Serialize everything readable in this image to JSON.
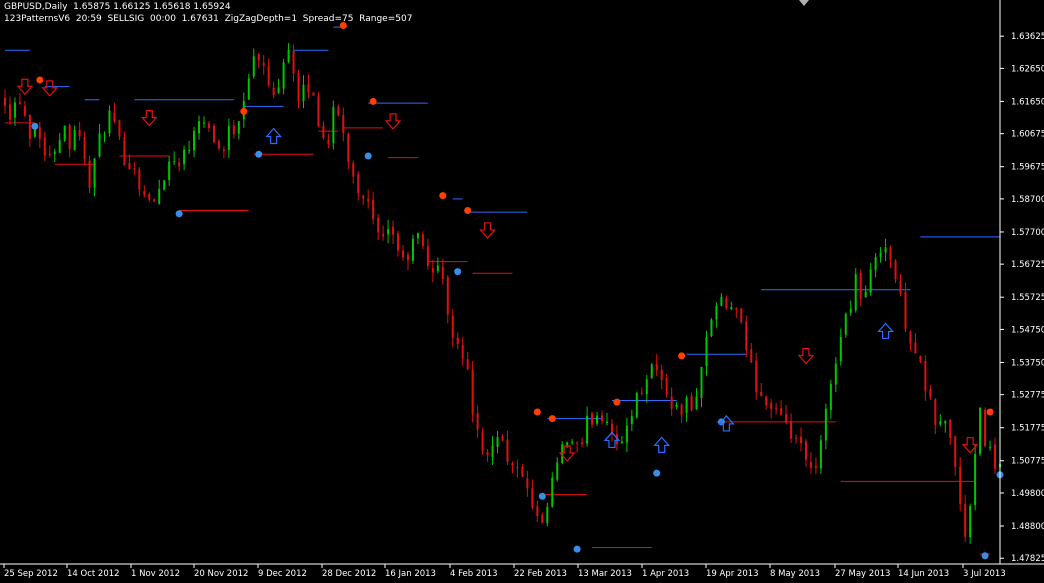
{
  "header": {
    "line1": "GBPUSD,Daily  1.65875 1.66125 1.65618 1.65924",
    "line2": "123PatternsV6  20:59  SELLSIG  00:00  1.67631  ZigZagDepth=1  Spread=75  Range=507"
  },
  "colors": {
    "background": "#000000",
    "bull": "#00c800",
    "bear": "#e01010",
    "resistance": "#2e6cff",
    "support": "#e01010",
    "pivot_high": "#ff4000",
    "pivot_low": "#3a8ee6",
    "sell_arrow": "#e01010",
    "buy_arrow": "#2e6cff",
    "axis": "#ffffff",
    "text": "#ffffff"
  },
  "chart_data": {
    "type": "candlestick",
    "symbol": "GBPUSD",
    "timeframe": "Daily",
    "ylim": [
      1.4765,
      1.6472
    ],
    "y_ticks": [
      "1.63625",
      "1.62650",
      "1.61650",
      "1.60675",
      "1.59675",
      "1.58700",
      "1.57700",
      "1.56725",
      "1.55725",
      "1.54750",
      "1.53750",
      "1.52775",
      "1.51775",
      "1.50775",
      "1.49800",
      "1.48800",
      "1.47825"
    ],
    "x_ticks": [
      "25 Sep 2012",
      "14 Oct 2012",
      "1 Nov 2012",
      "20 Nov 2012",
      "9 Dec 2012",
      "28 Dec 2012",
      "16 Jan 2013",
      "4 Feb 2013",
      "22 Feb 2013",
      "13 Mar 2013",
      "1 Apr 2013",
      "19 Apr 2013",
      "8 May 2013",
      "27 May 2013",
      "14 Jun 2013",
      "3 Jul 2013"
    ],
    "close_path": [
      1.618,
      1.612,
      1.6195,
      1.613,
      1.606,
      1.611,
      1.6005,
      1.5985,
      1.606,
      1.609,
      1.604,
      1.612,
      1.5985,
      1.592,
      1.601,
      1.608,
      1.6125,
      1.606,
      1.6005,
      1.598,
      1.5945,
      1.59,
      1.5855,
      1.586,
      1.5935,
      1.598,
      1.5985,
      1.6,
      1.602,
      1.6105,
      1.6135,
      1.609,
      1.606,
      1.6,
      1.606,
      1.609,
      1.613,
      1.624,
      1.629,
      1.629,
      1.623,
      1.6175,
      1.6245,
      1.635,
      1.6275,
      1.6135,
      1.6225,
      1.618,
      1.61,
      1.602,
      1.612,
      1.613,
      1.603,
      1.596,
      1.5905,
      1.588,
      1.581,
      1.575,
      1.5725,
      1.5785,
      1.572,
      1.5665,
      1.572,
      1.576,
      1.5705,
      1.565,
      1.568,
      1.56,
      1.5485,
      1.545,
      1.54,
      1.53,
      1.517,
      1.508,
      1.508,
      1.518,
      1.5135,
      1.508,
      1.503,
      1.505,
      1.4955,
      1.491,
      1.4855,
      1.495,
      1.505,
      1.5095,
      1.5145,
      1.5125,
      1.5095,
      1.5195,
      1.5215,
      1.5225,
      1.52,
      1.517,
      1.509,
      1.5185,
      1.525,
      1.528,
      1.5345,
      1.5375,
      1.533,
      1.529,
      1.5245,
      1.522,
      1.5255,
      1.522,
      1.533,
      1.542,
      1.552,
      1.556,
      1.5535,
      1.555,
      1.55,
      1.544,
      1.536,
      1.5295,
      1.5255,
      1.524,
      1.5225,
      1.517,
      1.5155,
      1.5145,
      1.508,
      1.5045,
      1.5045,
      1.5165,
      1.53,
      1.54,
      1.548,
      1.5545,
      1.564,
      1.5555,
      1.5615,
      1.57,
      1.5745,
      1.571,
      1.563,
      1.5545,
      1.5465,
      1.542,
      1.534,
      1.527,
      1.52,
      1.5185,
      1.5195,
      1.5085,
      1.492,
      1.4835,
      1.505,
      1.522,
      1.512,
      1.508,
      1.506
    ],
    "levels": [
      {
        "type": "resistance",
        "x0": 0,
        "x1": 5,
        "price": 1.632
      },
      {
        "type": "resistance",
        "x0": 8,
        "x1": 13,
        "price": 1.621
      },
      {
        "type": "resistance",
        "x0": 16,
        "x1": 19,
        "price": 1.617
      },
      {
        "type": "resistance",
        "x0": 26,
        "x1": 46,
        "price": 1.617
      },
      {
        "type": "resistance",
        "x0": 48,
        "x1": 56,
        "price": 1.615
      },
      {
        "type": "resistance",
        "x0": 58,
        "x1": 65,
        "price": 1.632
      },
      {
        "type": "resistance",
        "x0": 66,
        "x1": 68,
        "price": 1.639
      },
      {
        "type": "resistance",
        "x0": 73,
        "x1": 85,
        "price": 1.616
      },
      {
        "type": "resistance",
        "x0": 90,
        "x1": 92,
        "price": 1.587
      },
      {
        "type": "resistance",
        "x0": 93,
        "x1": 105,
        "price": 1.583
      },
      {
        "type": "resistance",
        "x0": 109,
        "x1": 120,
        "price": 1.5205
      },
      {
        "type": "resistance",
        "x0": 122,
        "x1": 135,
        "price": 1.526
      },
      {
        "type": "resistance",
        "x0": 137,
        "x1": 149,
        "price": 1.54
      },
      {
        "type": "resistance",
        "x0": 152,
        "x1": 182,
        "price": 1.5595
      },
      {
        "type": "resistance",
        "x0": 184,
        "x1": 200,
        "price": 1.5755
      },
      {
        "type": "support",
        "x0": 0,
        "x1": 6,
        "price": 1.61
      },
      {
        "type": "support",
        "x0": 10,
        "x1": 18,
        "price": 1.5975
      },
      {
        "type": "support",
        "x0": 23,
        "x1": 33,
        "price": 1.6
      },
      {
        "type": "support",
        "x0": 35,
        "x1": 49,
        "price": 1.5835
      },
      {
        "type": "support",
        "x0": 50,
        "x1": 62,
        "price": 1.6005
      },
      {
        "type": "support",
        "x0": 63,
        "x1": 67,
        "price": 1.6075
      },
      {
        "type": "support",
        "x0": 68,
        "x1": 76,
        "price": 1.6085
      },
      {
        "type": "support",
        "x0": 77,
        "x1": 83,
        "price": 1.5995
      },
      {
        "type": "support",
        "x0": 85,
        "x1": 93,
        "price": 1.568
      },
      {
        "type": "support",
        "x0": 94,
        "x1": 102,
        "price": 1.5645
      },
      {
        "type": "support",
        "x0": 108,
        "x1": 117,
        "price": 1.4975
      },
      {
        "type": "support",
        "x0": 118,
        "x1": 130,
        "price": 1.4815
      },
      {
        "type": "support",
        "x0": 143,
        "x1": 167,
        "price": 1.5195
      },
      {
        "type": "support",
        "x0": 168,
        "x1": 195,
        "price": 1.5015
      },
      {
        "type": "support",
        "x0": 196,
        "x1": 198,
        "price": 1.4795
      }
    ],
    "pivots": [
      {
        "type": "high",
        "x": 7,
        "price": 1.623
      },
      {
        "type": "low",
        "x": 6,
        "price": 1.609
      },
      {
        "type": "low",
        "x": 35,
        "price": 1.5825
      },
      {
        "type": "high",
        "x": 48,
        "price": 1.6135
      },
      {
        "type": "low",
        "x": 51,
        "price": 1.6005
      },
      {
        "type": "high",
        "x": 68,
        "price": 1.6395
      },
      {
        "type": "high",
        "x": 74,
        "price": 1.6165
      },
      {
        "type": "low",
        "x": 73,
        "price": 1.6
      },
      {
        "type": "high",
        "x": 88,
        "price": 1.588
      },
      {
        "type": "high",
        "x": 93,
        "price": 1.5835
      },
      {
        "type": "low",
        "x": 91,
        "price": 1.565
      },
      {
        "type": "high",
        "x": 107,
        "price": 1.5225
      },
      {
        "type": "high",
        "x": 110,
        "price": 1.5205
      },
      {
        "type": "low",
        "x": 108,
        "price": 1.497
      },
      {
        "type": "low",
        "x": 115,
        "price": 1.481
      },
      {
        "type": "high",
        "x": 123,
        "price": 1.5255
      },
      {
        "type": "low",
        "x": 131,
        "price": 1.504
      },
      {
        "type": "high",
        "x": 136,
        "price": 1.5395
      },
      {
        "type": "low",
        "x": 144,
        "price": 1.5195
      },
      {
        "type": "low",
        "x": 197,
        "price": 1.479
      },
      {
        "type": "high",
        "x": 198,
        "price": 1.5225
      },
      {
        "type": "low",
        "x": 200,
        "price": 1.5035
      }
    ],
    "signals": [
      {
        "type": "sell",
        "x": 4,
        "price": 1.6205
      },
      {
        "type": "sell",
        "x": 9,
        "price": 1.62
      },
      {
        "type": "sell",
        "x": 29,
        "price": 1.611
      },
      {
        "type": "buy",
        "x": 54,
        "price": 1.6065
      },
      {
        "type": "sell",
        "x": 78,
        "price": 1.61
      },
      {
        "type": "sell",
        "x": 97,
        "price": 1.577
      },
      {
        "type": "sell",
        "x": 113,
        "price": 1.5095
      },
      {
        "type": "buy",
        "x": 122,
        "price": 1.5145
      },
      {
        "type": "buy",
        "x": 132,
        "price": 1.513
      },
      {
        "type": "buy",
        "x": 145,
        "price": 1.5195
      },
      {
        "type": "sell",
        "x": 161,
        "price": 1.539
      },
      {
        "type": "buy",
        "x": 177,
        "price": 1.5475
      },
      {
        "type": "sell",
        "x": 194,
        "price": 1.512
      }
    ]
  }
}
